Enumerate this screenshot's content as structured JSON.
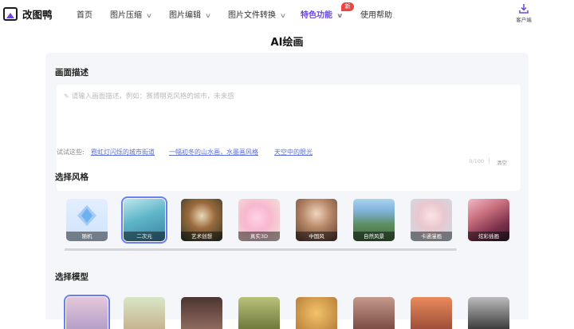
{
  "brand": {
    "name": "改图鸭",
    "accent": "#6b46e5"
  },
  "nav": {
    "home": "首页",
    "compress": "图片压缩",
    "edit": "图片编辑",
    "convert": "图片文件转换",
    "features": "特色功能",
    "features_badge": "新",
    "help": "使用帮助",
    "client": "客户端"
  },
  "page": {
    "title": "AI绘画"
  },
  "description": {
    "title": "画面描述",
    "placeholder": "请输入画面描述，例如：赛博朋克风格的城市，未来感",
    "count": "0/100",
    "clear": "清空"
  },
  "suggestions": {
    "label": "试试这些:",
    "items": [
      "霓虹灯闪烁的城市街道",
      "一幅初冬的山水画，水墨画风格",
      "天空中的眼光"
    ]
  },
  "styles": {
    "title": "选择风格",
    "selected_index": 1,
    "items": [
      {
        "label": "随机",
        "icon": "diamond-icon"
      },
      {
        "label": "二次元"
      },
      {
        "label": "艺术创想"
      },
      {
        "label": "真实3D"
      },
      {
        "label": "中国风"
      },
      {
        "label": "自然风景"
      },
      {
        "label": "卡通漫画"
      },
      {
        "label": "炫彩插画"
      }
    ]
  },
  "models": {
    "title": "选择模型",
    "selected_index": 0
  },
  "colors": {
    "link": "#5b6fd6",
    "selected_border": "#6b7ff0",
    "badge": "#ef4444",
    "panel_bg": "#f5f6fa"
  }
}
